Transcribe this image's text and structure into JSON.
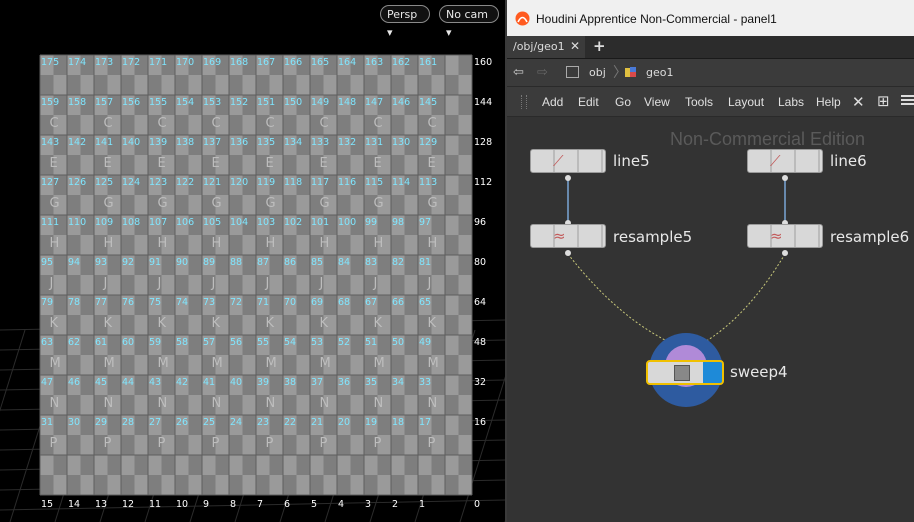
{
  "viewport": {
    "persp_label": "Persp",
    "cam_label": "No cam",
    "grid_rows": [
      {
        "numbers": [
          "175",
          "174",
          "173",
          "172",
          "171",
          "170",
          "169",
          "168",
          "167",
          "166",
          "165",
          "164",
          "163",
          "162",
          "161",
          "160"
        ],
        "letter": ""
      },
      {
        "numbers": [
          "159",
          "158",
          "157",
          "156",
          "155",
          "154",
          "153",
          "152",
          "151",
          "150",
          "149",
          "148",
          "147",
          "146",
          "145",
          "144"
        ],
        "letter": "C"
      },
      {
        "numbers": [
          "143",
          "142",
          "141",
          "140",
          "139",
          "138",
          "137",
          "136",
          "135",
          "134",
          "133",
          "132",
          "131",
          "130",
          "129",
          "128"
        ],
        "letter": "E"
      },
      {
        "numbers": [
          "127",
          "126",
          "125",
          "124",
          "123",
          "122",
          "121",
          "120",
          "119",
          "118",
          "117",
          "116",
          "115",
          "114",
          "113",
          "112"
        ],
        "letter": "G"
      },
      {
        "numbers": [
          "111",
          "110",
          "109",
          "108",
          "107",
          "106",
          "105",
          "104",
          "103",
          "102",
          "101",
          "100",
          "99",
          "98",
          "97",
          "96"
        ],
        "letter": "H"
      },
      {
        "numbers": [
          "95",
          "94",
          "93",
          "92",
          "91",
          "90",
          "89",
          "88",
          "87",
          "86",
          "85",
          "84",
          "83",
          "82",
          "81",
          "80"
        ],
        "letter": "J"
      },
      {
        "numbers": [
          "79",
          "78",
          "77",
          "76",
          "75",
          "74",
          "73",
          "72",
          "71",
          "70",
          "69",
          "68",
          "67",
          "66",
          "65",
          "64"
        ],
        "letter": "K"
      },
      {
        "numbers": [
          "63",
          "62",
          "61",
          "60",
          "59",
          "58",
          "57",
          "56",
          "55",
          "54",
          "53",
          "52",
          "51",
          "50",
          "49",
          "48"
        ],
        "letter": "M"
      },
      {
        "numbers": [
          "47",
          "46",
          "45",
          "44",
          "43",
          "42",
          "41",
          "40",
          "39",
          "38",
          "37",
          "36",
          "35",
          "34",
          "33",
          "32"
        ],
        "letter": "N"
      },
      {
        "numbers": [
          "31",
          "30",
          "29",
          "28",
          "27",
          "26",
          "25",
          "24",
          "23",
          "22",
          "21",
          "20",
          "19",
          "18",
          "17",
          "16"
        ],
        "letter": "P"
      },
      {
        "numbers": [
          "15",
          "14",
          "13",
          "12",
          "11",
          "10",
          "9",
          "8",
          "7",
          "6",
          "5",
          "4",
          "3",
          "2",
          "1",
          "0"
        ],
        "letter": ""
      }
    ]
  },
  "window": {
    "title": "Houdini Apprentice Non-Commercial - panel1"
  },
  "tabs": {
    "active_label": "/obj/geo1",
    "close_glyph": "✕",
    "add_glyph": "+"
  },
  "path": {
    "back_glyph": "⇦",
    "forward_glyph": "⇨",
    "obj_label": "obj",
    "geo_label": "geo1"
  },
  "menu": {
    "items": [
      "Add",
      "Edit",
      "Go",
      "View",
      "Tools",
      "Layout",
      "Labs",
      "Help"
    ]
  },
  "network": {
    "watermark": "Non-Commercial Edition",
    "nodes": {
      "line5": "line5",
      "line6": "line6",
      "resample5": "resample5",
      "resample6": "resample6",
      "sweep4": "sweep4"
    }
  },
  "colors": {
    "accent_blue": "#1e8ad8",
    "selected_outline": "#f0c000",
    "grid_label_cyan": "#5fe0ff"
  },
  "icons": [
    "houdini-logo-icon",
    "back-arrow-icon",
    "forward-arrow-icon",
    "obj-context-icon",
    "geo-context-icon",
    "tools-icon",
    "tree-view-icon",
    "list-view-icon",
    "line-sop-icon",
    "resample-sop-icon",
    "sweep-sop-icon"
  ]
}
